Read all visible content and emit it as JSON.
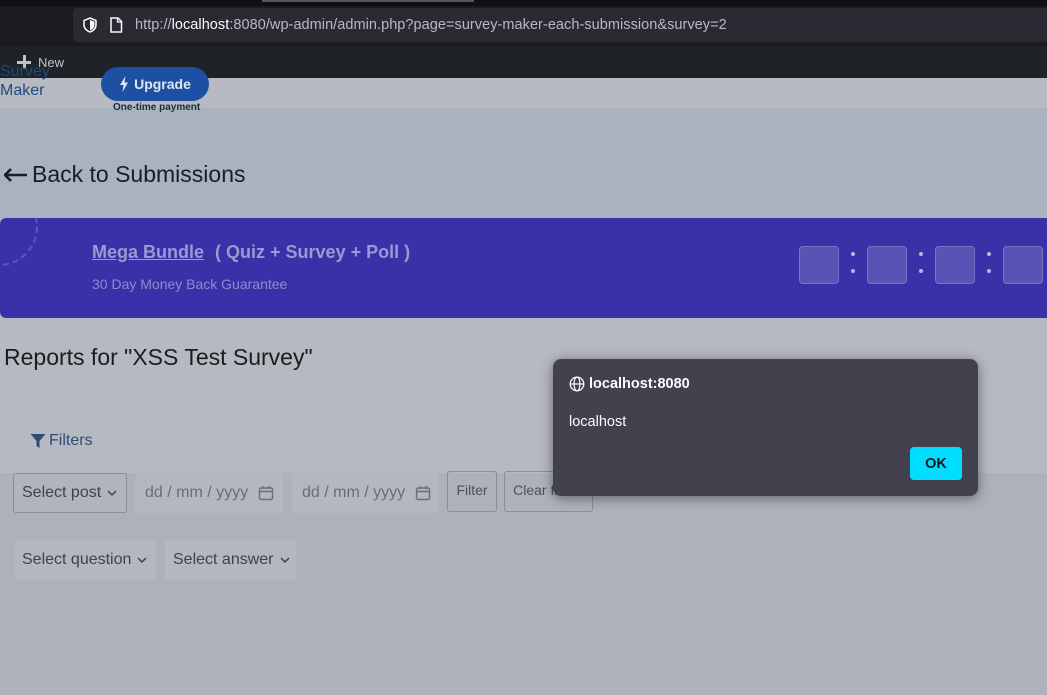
{
  "browser": {
    "url_prefix": "http://",
    "url_host": "localhost",
    "url_rest": ":8080/wp-admin/admin.php?page=survey-maker-each-submission&survey=2"
  },
  "adminbar": {
    "new_label": "New"
  },
  "header": {
    "brand": "Survey Maker",
    "upgrade_label": "Upgrade",
    "upgrade_note": "One-time payment"
  },
  "back_link": "Back to Submissions",
  "promo": {
    "title_link": "Mega Bundle",
    "title_rest": "( Quiz + Survey + Poll )",
    "subtitle": "30 Day Money Back Guarantee"
  },
  "reports_title": "Reports for \"XSS Test Survey\"",
  "filters": {
    "label": "Filters",
    "select_post": "Select post",
    "date_placeholder": "dd / mm / yyyy",
    "filter_button": "Filter",
    "clear_button": "Clear filters",
    "select_question": "Select question",
    "select_answer": "Select answer"
  },
  "dialog": {
    "origin": "localhost:8080",
    "message": "localhost",
    "ok_label": "OK"
  },
  "colors": {
    "dialog_bg": "#42414d",
    "ok_button": "#00ddff",
    "promo_bg": "#3a31a8",
    "upgrade_bg": "#1d4fa3"
  }
}
